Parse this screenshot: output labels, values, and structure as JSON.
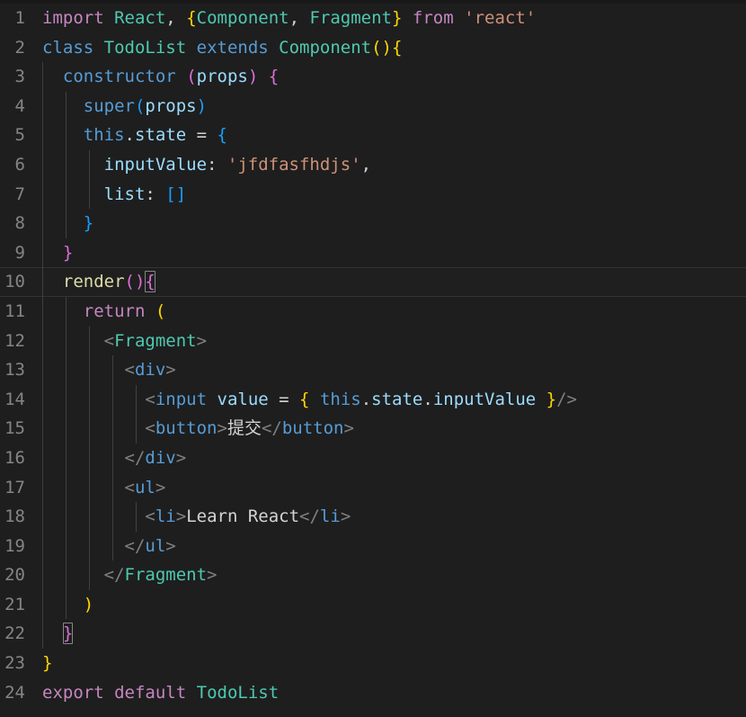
{
  "editor": {
    "name": "code-editor",
    "language": "javascript-react-jsx",
    "theme": "dark-plus",
    "background_color": "#1e1e1e",
    "gutter_color": "#858585",
    "active_line_number": 10,
    "cursor_line": 10,
    "cursor_column": 11,
    "bracket_match_lines": [
      10,
      22
    ],
    "total_lines": 24,
    "font_size_px": 19,
    "line_height_px": 32.6,
    "colors": {
      "keyword_control": "#c586c0",
      "keyword_declaration": "#569cd6",
      "type": "#4ec9b0",
      "variable": "#9cdcfe",
      "string": "#ce9178",
      "function": "#dcdcaa",
      "tag_punctuation": "#808080",
      "plain_text": "#d4d4d4",
      "bracket_1": "#ffd700",
      "bracket_2": "#da70d6",
      "bracket_3": "#179fff",
      "indent_guide": "#404040",
      "active_line_border": "#333333"
    }
  },
  "lines": [
    {
      "n": 1,
      "num_label": "1",
      "text": "import React, {Component, Fragment} from 'react'"
    },
    {
      "n": 2,
      "num_label": "2",
      "text": "class TodoList extends Component(){"
    },
    {
      "n": 3,
      "num_label": "3",
      "text": "  constructor (props) {"
    },
    {
      "n": 4,
      "num_label": "4",
      "text": "    super(props)"
    },
    {
      "n": 5,
      "num_label": "5",
      "text": "    this.state = {"
    },
    {
      "n": 6,
      "num_label": "6",
      "text": "      inputValue: 'jfdfasfhdjs',"
    },
    {
      "n": 7,
      "num_label": "7",
      "text": "      list: []"
    },
    {
      "n": 8,
      "num_label": "8",
      "text": "    }"
    },
    {
      "n": 9,
      "num_label": "9",
      "text": "  }"
    },
    {
      "n": 10,
      "num_label": "10",
      "text": "  render(){"
    },
    {
      "n": 11,
      "num_label": "11",
      "text": "    return ("
    },
    {
      "n": 12,
      "num_label": "12",
      "text": "      <Fragment>"
    },
    {
      "n": 13,
      "num_label": "13",
      "text": "        <div>"
    },
    {
      "n": 14,
      "num_label": "14",
      "text": "          <input value = { this.state.inputValue }/>"
    },
    {
      "n": 15,
      "num_label": "15",
      "text": "          <button>提交</button>"
    },
    {
      "n": 16,
      "num_label": "16",
      "text": "        </div>"
    },
    {
      "n": 17,
      "num_label": "17",
      "text": "        <ul>"
    },
    {
      "n": 18,
      "num_label": "18",
      "text": "          <li>Learn React</li>"
    },
    {
      "n": 19,
      "num_label": "19",
      "text": "        </ul>"
    },
    {
      "n": 20,
      "num_label": "20",
      "text": "      </Fragment>"
    },
    {
      "n": 21,
      "num_label": "21",
      "text": "    )"
    },
    {
      "n": 22,
      "num_label": "22",
      "text": "  }"
    },
    {
      "n": 23,
      "num_label": "23",
      "text": "}"
    },
    {
      "n": 24,
      "num_label": "24",
      "text": "export default TodoList"
    }
  ]
}
